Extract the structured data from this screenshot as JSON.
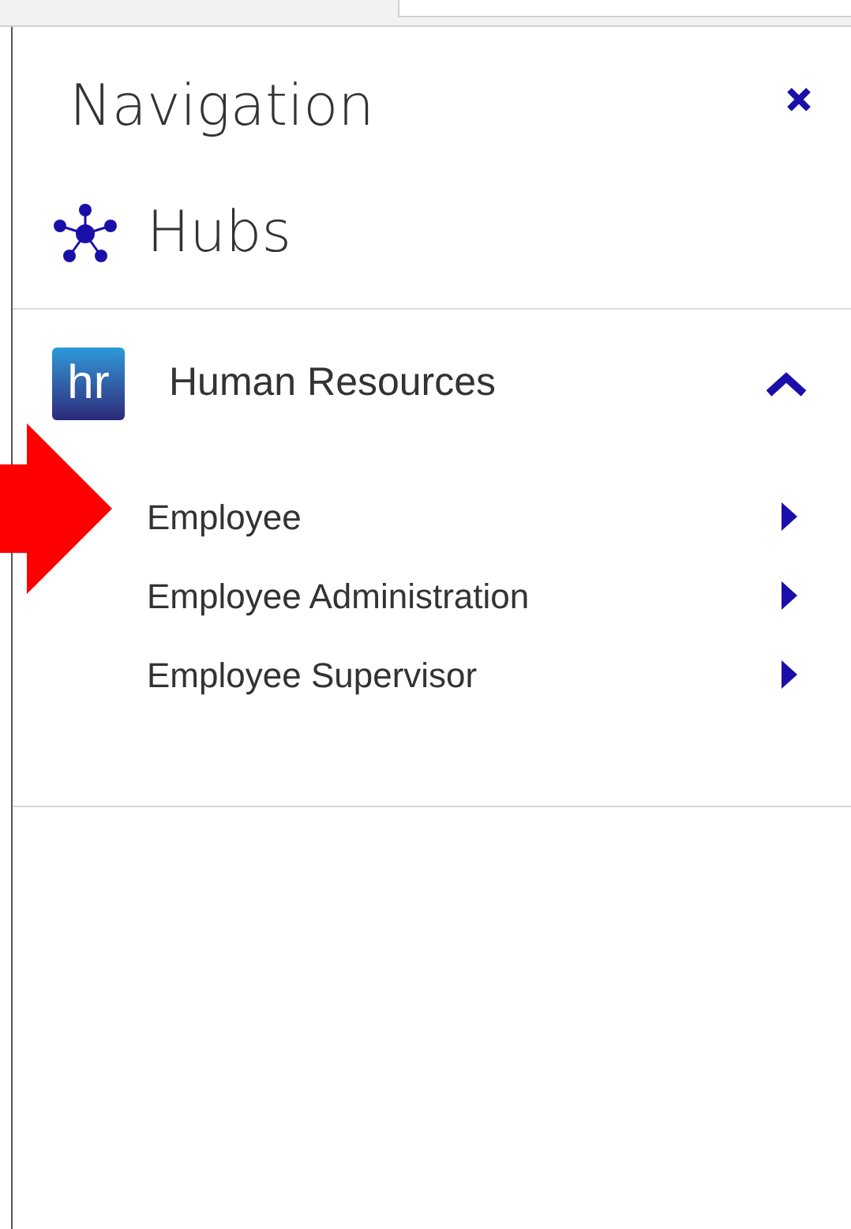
{
  "title": "Navigation",
  "section": {
    "label": "Hubs"
  },
  "hub": {
    "logo_text": "hr",
    "label": "Human Resources",
    "expanded": true,
    "items": [
      {
        "label": "Employee"
      },
      {
        "label": "Employee Administration"
      },
      {
        "label": "Employee Supervisor"
      }
    ]
  }
}
